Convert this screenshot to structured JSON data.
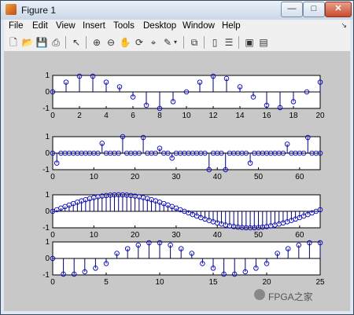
{
  "window": {
    "title": "Figure 1"
  },
  "window_buttons": {
    "minimize": "—",
    "maximize": "□",
    "close": "✕"
  },
  "menu": [
    "File",
    "Edit",
    "View",
    "Insert",
    "Tools",
    "Desktop",
    "Window",
    "Help"
  ],
  "toolbar": {
    "icons": [
      "new-figure-icon",
      "open-file-icon",
      "save-figure-icon",
      "print-figure-icon",
      "pointer-icon",
      "zoom-in-icon",
      "zoom-out-icon",
      "pan-icon",
      "rotate-3d-icon",
      "data-cursor-icon",
      "brush-icon",
      "link-plot-icon",
      "insert-colorbar-icon",
      "insert-legend-icon",
      "hide-plot-tools-icon",
      "show-plot-tools-icon"
    ]
  },
  "watermark": {
    "text": "FPGA之家"
  },
  "chart_data": [
    {
      "type": "stem",
      "x": [
        0,
        1,
        2,
        3,
        4,
        5,
        6,
        7,
        8,
        9,
        10,
        11,
        12,
        13,
        14,
        15,
        16,
        17,
        18,
        19,
        20
      ],
      "values": [
        0,
        0.59,
        0.95,
        0.95,
        0.59,
        0.31,
        -0.31,
        -0.81,
        -1.0,
        -0.59,
        0,
        0.59,
        0.95,
        0.81,
        0.31,
        -0.31,
        -0.81,
        -0.95,
        -0.59,
        0,
        0.59
      ],
      "xlim": [
        0,
        20
      ],
      "ylim": [
        -1,
        1
      ],
      "xticks": [
        "0",
        "2",
        "4",
        "6",
        "8",
        "10",
        "12",
        "14",
        "16",
        "18",
        "20"
      ],
      "yticks": [
        "1",
        "0",
        "-1"
      ]
    },
    {
      "type": "stem",
      "x": [
        0,
        1,
        2,
        3,
        4,
        5,
        6,
        7,
        8,
        9,
        10,
        11,
        12,
        13,
        14,
        15,
        16,
        17,
        18,
        19,
        20,
        21,
        22,
        23,
        24,
        25,
        26,
        27,
        28,
        29,
        30,
        31,
        32,
        33,
        34,
        35,
        36,
        37,
        38,
        39,
        40,
        41,
        42,
        43,
        44,
        45,
        46,
        47,
        48,
        49,
        50,
        51,
        52,
        53,
        54,
        55,
        56,
        57,
        58,
        59,
        60,
        61,
        62,
        63,
        64,
        65
      ],
      "values": [
        0,
        -0.6,
        0,
        0,
        0,
        0,
        0,
        0,
        0,
        0,
        0,
        0,
        0.6,
        0,
        0,
        0,
        0,
        1,
        0,
        0,
        0,
        0,
        0.95,
        0,
        0,
        0,
        0.3,
        0,
        0,
        -0.3,
        0,
        0,
        0,
        0,
        0,
        0,
        0,
        0,
        -1,
        0,
        0,
        0,
        -1,
        0,
        0,
        0,
        0,
        0,
        -0.6,
        0,
        0,
        0,
        0,
        0,
        0,
        0,
        0,
        0.55,
        0,
        0,
        0,
        0,
        0.95,
        0,
        0,
        0
      ],
      "xlim": [
        0,
        65
      ],
      "ylim": [
        -1,
        1
      ],
      "xticks": [
        "0",
        "10",
        "20",
        "30",
        "40",
        "50",
        "60"
      ],
      "yticks": [
        "1",
        "0",
        "-1"
      ]
    },
    {
      "type": "stem",
      "n_points": 66,
      "function": "sin(2*pi*x/64)",
      "xlim": [
        0,
        65
      ],
      "ylim": [
        -1,
        1
      ],
      "xticks": [
        "0",
        "10",
        "20",
        "30",
        "40",
        "50",
        "60"
      ],
      "yticks": [
        "1",
        "0",
        "-1"
      ]
    },
    {
      "type": "stem",
      "x": [
        0,
        1,
        2,
        3,
        4,
        5,
        6,
        7,
        8,
        9,
        10,
        11,
        12,
        13,
        14,
        15,
        16,
        17,
        18,
        19,
        20,
        21,
        22,
        23,
        24,
        25
      ],
      "values": [
        0,
        -0.95,
        -0.95,
        -0.81,
        -0.59,
        -0.31,
        0.31,
        0.59,
        0.81,
        0.95,
        0.95,
        0.81,
        0.59,
        0.31,
        -0.31,
        -0.59,
        -0.95,
        -0.95,
        -0.81,
        -0.59,
        -0.31,
        0.31,
        0.59,
        0.81,
        0.95,
        0.95
      ],
      "xlim": [
        0,
        25
      ],
      "ylim": [
        -1,
        1
      ],
      "xticks": [
        "0",
        "5",
        "10",
        "15",
        "20",
        "25"
      ],
      "yticks": [
        "1",
        "0",
        "-1"
      ]
    }
  ]
}
